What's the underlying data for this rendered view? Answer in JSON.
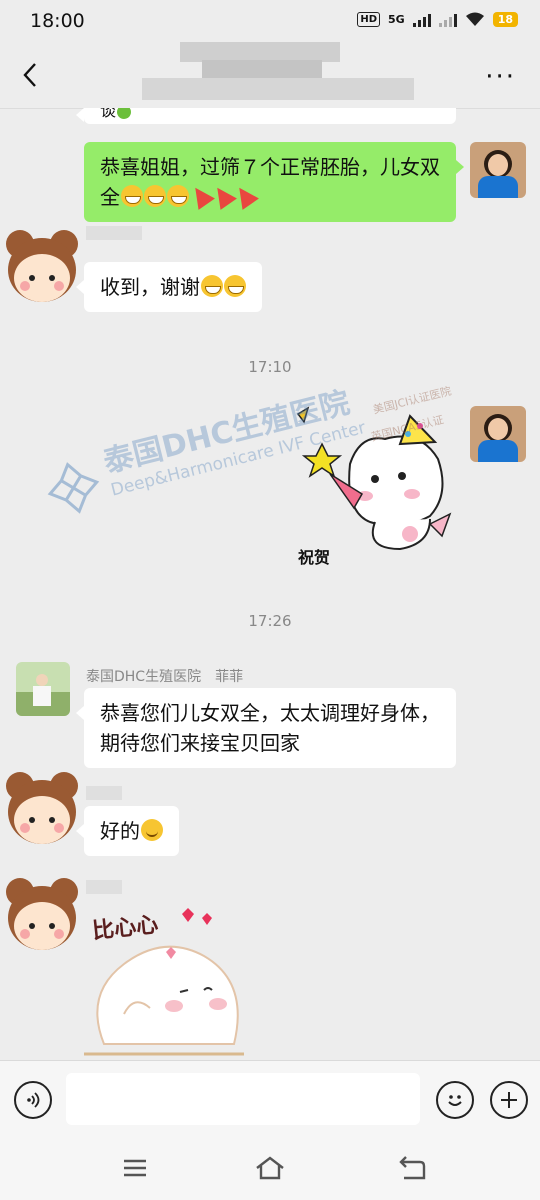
{
  "status_bar": {
    "time": "18:00",
    "hd_label": "HD",
    "network_label": "5G",
    "battery": "18"
  },
  "header": {
    "back_icon": "chevron-left-icon",
    "more_label": "···"
  },
  "messages": [
    {
      "type": "text",
      "side": "left",
      "text": "谈",
      "partial": true
    },
    {
      "type": "text",
      "side": "right",
      "text": "恭喜姐姐，过筛７个正常胚胎，儿女双全",
      "emojis": [
        "hug",
        "hug",
        "hug",
        "party",
        "party",
        "party"
      ]
    },
    {
      "type": "text",
      "side": "left",
      "text": "收到，谢谢",
      "emojis": [
        "grin",
        "grin"
      ]
    },
    {
      "type": "timestamp",
      "text": "17:10"
    },
    {
      "type": "sticker",
      "side": "right",
      "caption": "祝贺"
    },
    {
      "type": "timestamp",
      "text": "17:26"
    },
    {
      "type": "text",
      "side": "left",
      "sender": "泰国DHC生殖医院　菲菲",
      "text": "恭喜您们儿女双全，太太调理好身体，期待您们来接宝贝回家"
    },
    {
      "type": "text",
      "side": "left",
      "text": "好的",
      "emojis": [
        "smile"
      ]
    },
    {
      "type": "sticker",
      "side": "left",
      "caption": "比心心"
    }
  ],
  "watermark": {
    "line1": "泰国DHC生殖医院",
    "line2": "Deep&Harmonicare IVF Center",
    "stamp1": "美国JCI认证医院",
    "stamp2": "英国NCAS认证"
  },
  "input_bar": {
    "voice_icon": "voice-icon",
    "emoji_icon": "smiley-icon",
    "plus_icon": "plus-icon",
    "value": ""
  },
  "system_nav": {
    "menu_icon": "menu-icon",
    "home_icon": "home-icon",
    "back_icon": "return-icon"
  },
  "colors": {
    "background": "#ededed",
    "sent_bubble": "#95ec69",
    "received_bubble": "#ffffff"
  }
}
